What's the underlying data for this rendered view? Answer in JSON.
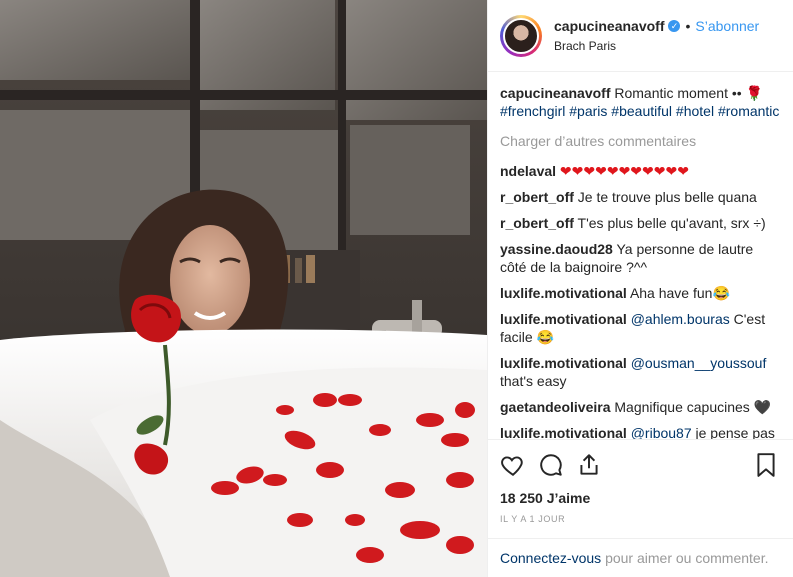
{
  "header": {
    "username": "capucineanavoff",
    "follow_label": "S’abonner",
    "location": "Brach Paris",
    "separator": "•"
  },
  "caption": {
    "username": "capucineanavoff",
    "text": "Romantic moment •• 🌹",
    "tags": [
      "#frenchgirl",
      "#paris",
      "#beautiful",
      "#hotel",
      "#romantic"
    ]
  },
  "load_more": "Charger d’autres commentaires",
  "comments": [
    {
      "user": "ndelaval",
      "text": "❤❤❤❤❤❤❤❤❤❤❤"
    },
    {
      "user": "r_obert_off",
      "text": "Je te trouve plus belle quana"
    },
    {
      "user": "r_obert_off",
      "text": "T'es plus belle qu'avant, srx ÷)"
    },
    {
      "user": "yassine.daoud28",
      "text": "Ya personne de lautre côté de la baignoire ?^^"
    },
    {
      "user": "luxlife.motivational",
      "text": "Aha have fun😂"
    },
    {
      "user": "luxlife.motivational",
      "mention": "@ahlem.bouras",
      "text": "C'est facile 😂"
    },
    {
      "user": "luxlife.motivational",
      "mention": "@ousman__youssouf",
      "text": "that's easy"
    },
    {
      "user": "gaetandeoliveira",
      "text": "Magnifique capucines 🖤"
    },
    {
      "user": "luxlife.motivational",
      "mention": "@ribou87",
      "text": "je pense pas 😂😂"
    }
  ],
  "likes": "18 250 J’aime",
  "age": "IL Y A 1 JOUR",
  "login": {
    "link": "Connectez-vous",
    "text": "pour aimer ou commenter."
  },
  "icons": [
    "heart-icon",
    "comment-icon",
    "share-icon",
    "bookmark-icon"
  ],
  "colors": {
    "accent": "#3897f0",
    "link": "#003569",
    "muted": "#999999"
  }
}
